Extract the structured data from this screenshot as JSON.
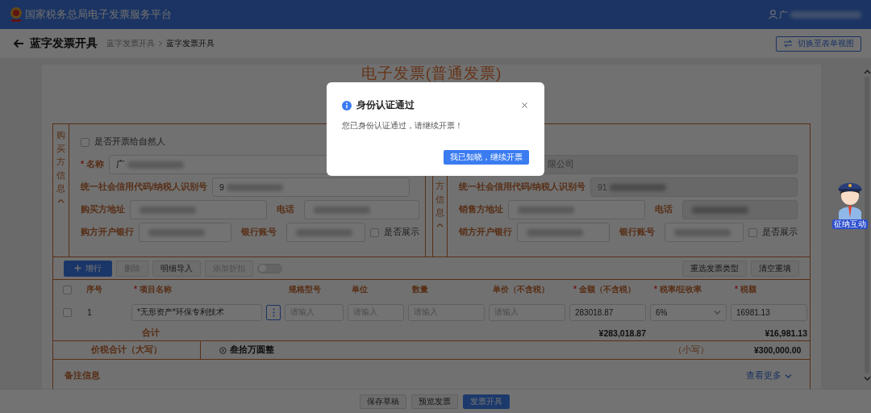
{
  "header": {
    "title": "国家税务总局电子发票服务平台",
    "user": "广"
  },
  "page": {
    "title": "蓝字发票开具",
    "breadcrumb": [
      {
        "label": "蓝字发票开具",
        "current": false
      },
      {
        "label": "蓝字发票开具",
        "current": true
      }
    ],
    "switch_button": "切换至表单视图"
  },
  "invoice": {
    "title": "电子发票(普通发票)",
    "buyer": {
      "label": "购买方信息",
      "natural_person": {
        "label": "是否开票给自然人",
        "checked": false
      },
      "name_mark": "*",
      "name_label": "名称",
      "name": {
        "value": "广",
        "redacted": true,
        "disabled": false
      },
      "credit_label": "统一社会信用代码/纳税人识别号",
      "credit": {
        "value": "9",
        "redacted": true,
        "disabled": false
      },
      "address_label": "购买方地址",
      "address": {
        "redacted": true,
        "disabled": false
      },
      "phone_label": "电话",
      "phone": {
        "redacted": true,
        "disabled": false
      },
      "bank_label": "购方开户银行",
      "bank": {
        "redacted": true,
        "disabled": false
      },
      "account_label": "银行账号",
      "account": {
        "redacted": true,
        "disabled": false
      },
      "show": {
        "label": "是否展示",
        "checked": false
      }
    },
    "seller": {
      "label": "方信息",
      "name": {
        "value": "限公司",
        "redacted": false,
        "disabled": true
      },
      "credit_label": "统一社会信用代码/纳税人识别号",
      "credit": {
        "value": "91",
        "redacted": true,
        "disabled": true
      },
      "address_label": "销售方地址",
      "address": {
        "redacted": true,
        "disabled": false
      },
      "phone_label": "电话",
      "phone": {
        "redacted": true,
        "disabled": true
      },
      "bank_label": "销方开户银行",
      "bank": {
        "redacted": true,
        "disabled": false
      },
      "account_label": "银行账号",
      "account": {
        "redacted": true,
        "disabled": false
      },
      "show": {
        "label": "是否展示",
        "checked": false
      }
    }
  },
  "toolbar": {
    "left": [
      {
        "label": "增行",
        "kind": "primary",
        "disabled": false
      },
      {
        "label": "删除",
        "kind": "default",
        "disabled": true
      },
      {
        "label": "明细导入",
        "kind": "default",
        "disabled": false
      },
      {
        "label": "添加折扣",
        "kind": "default",
        "disabled": true
      }
    ],
    "tax_toggle": {
      "on": false
    },
    "right": [
      {
        "label": "重选发票类型",
        "kind": "default",
        "disabled": false
      },
      {
        "label": "清空重填",
        "kind": "default",
        "disabled": false
      }
    ]
  },
  "table": {
    "select_all": {
      "checked": false
    },
    "columns": [
      {
        "label": "序号"
      },
      {
        "mark": "*",
        "label": "项目名称"
      },
      {
        "label": "规格型号"
      },
      {
        "label": "单位"
      },
      {
        "label": "数量"
      },
      {
        "label": "单价（不含税）"
      },
      {
        "mark": "*",
        "label": "金额（不含税）"
      },
      {
        "mark": "*",
        "label": "税率/征收率"
      },
      {
        "mark": "*",
        "label": "税额"
      }
    ],
    "rows": [
      {
        "selected": false,
        "index": "1",
        "item": "*无形资产*环保专利技术",
        "spec_placeholder": "请输入",
        "unit_placeholder": "请输入",
        "quantity_placeholder": "请输入",
        "price_placeholder": "请输入",
        "amount": "283018.87",
        "rate": "6%",
        "tax": "16981.13"
      }
    ],
    "total": {
      "label": "合计",
      "amount": "¥283,018.87",
      "tax": "¥16,981.13"
    }
  },
  "grand_total": {
    "label": "价税合计（大写）",
    "words": "叁拾万圆整",
    "small_label": "（小写）",
    "amount": "¥300,000.00"
  },
  "remarks": {
    "label": "备注信息",
    "more": "查看更多"
  },
  "footer": [
    {
      "label": "保存草稿",
      "kind": "default"
    },
    {
      "label": "预览发票",
      "kind": "default"
    },
    {
      "label": "发票开具",
      "kind": "primary"
    }
  ],
  "mascot": {
    "badge": "征纳互动"
  },
  "dialog": {
    "title": "身份认证通过",
    "message": "您已身份认证通过，请继续开票！",
    "button": "我已知晓，继续开票"
  }
}
